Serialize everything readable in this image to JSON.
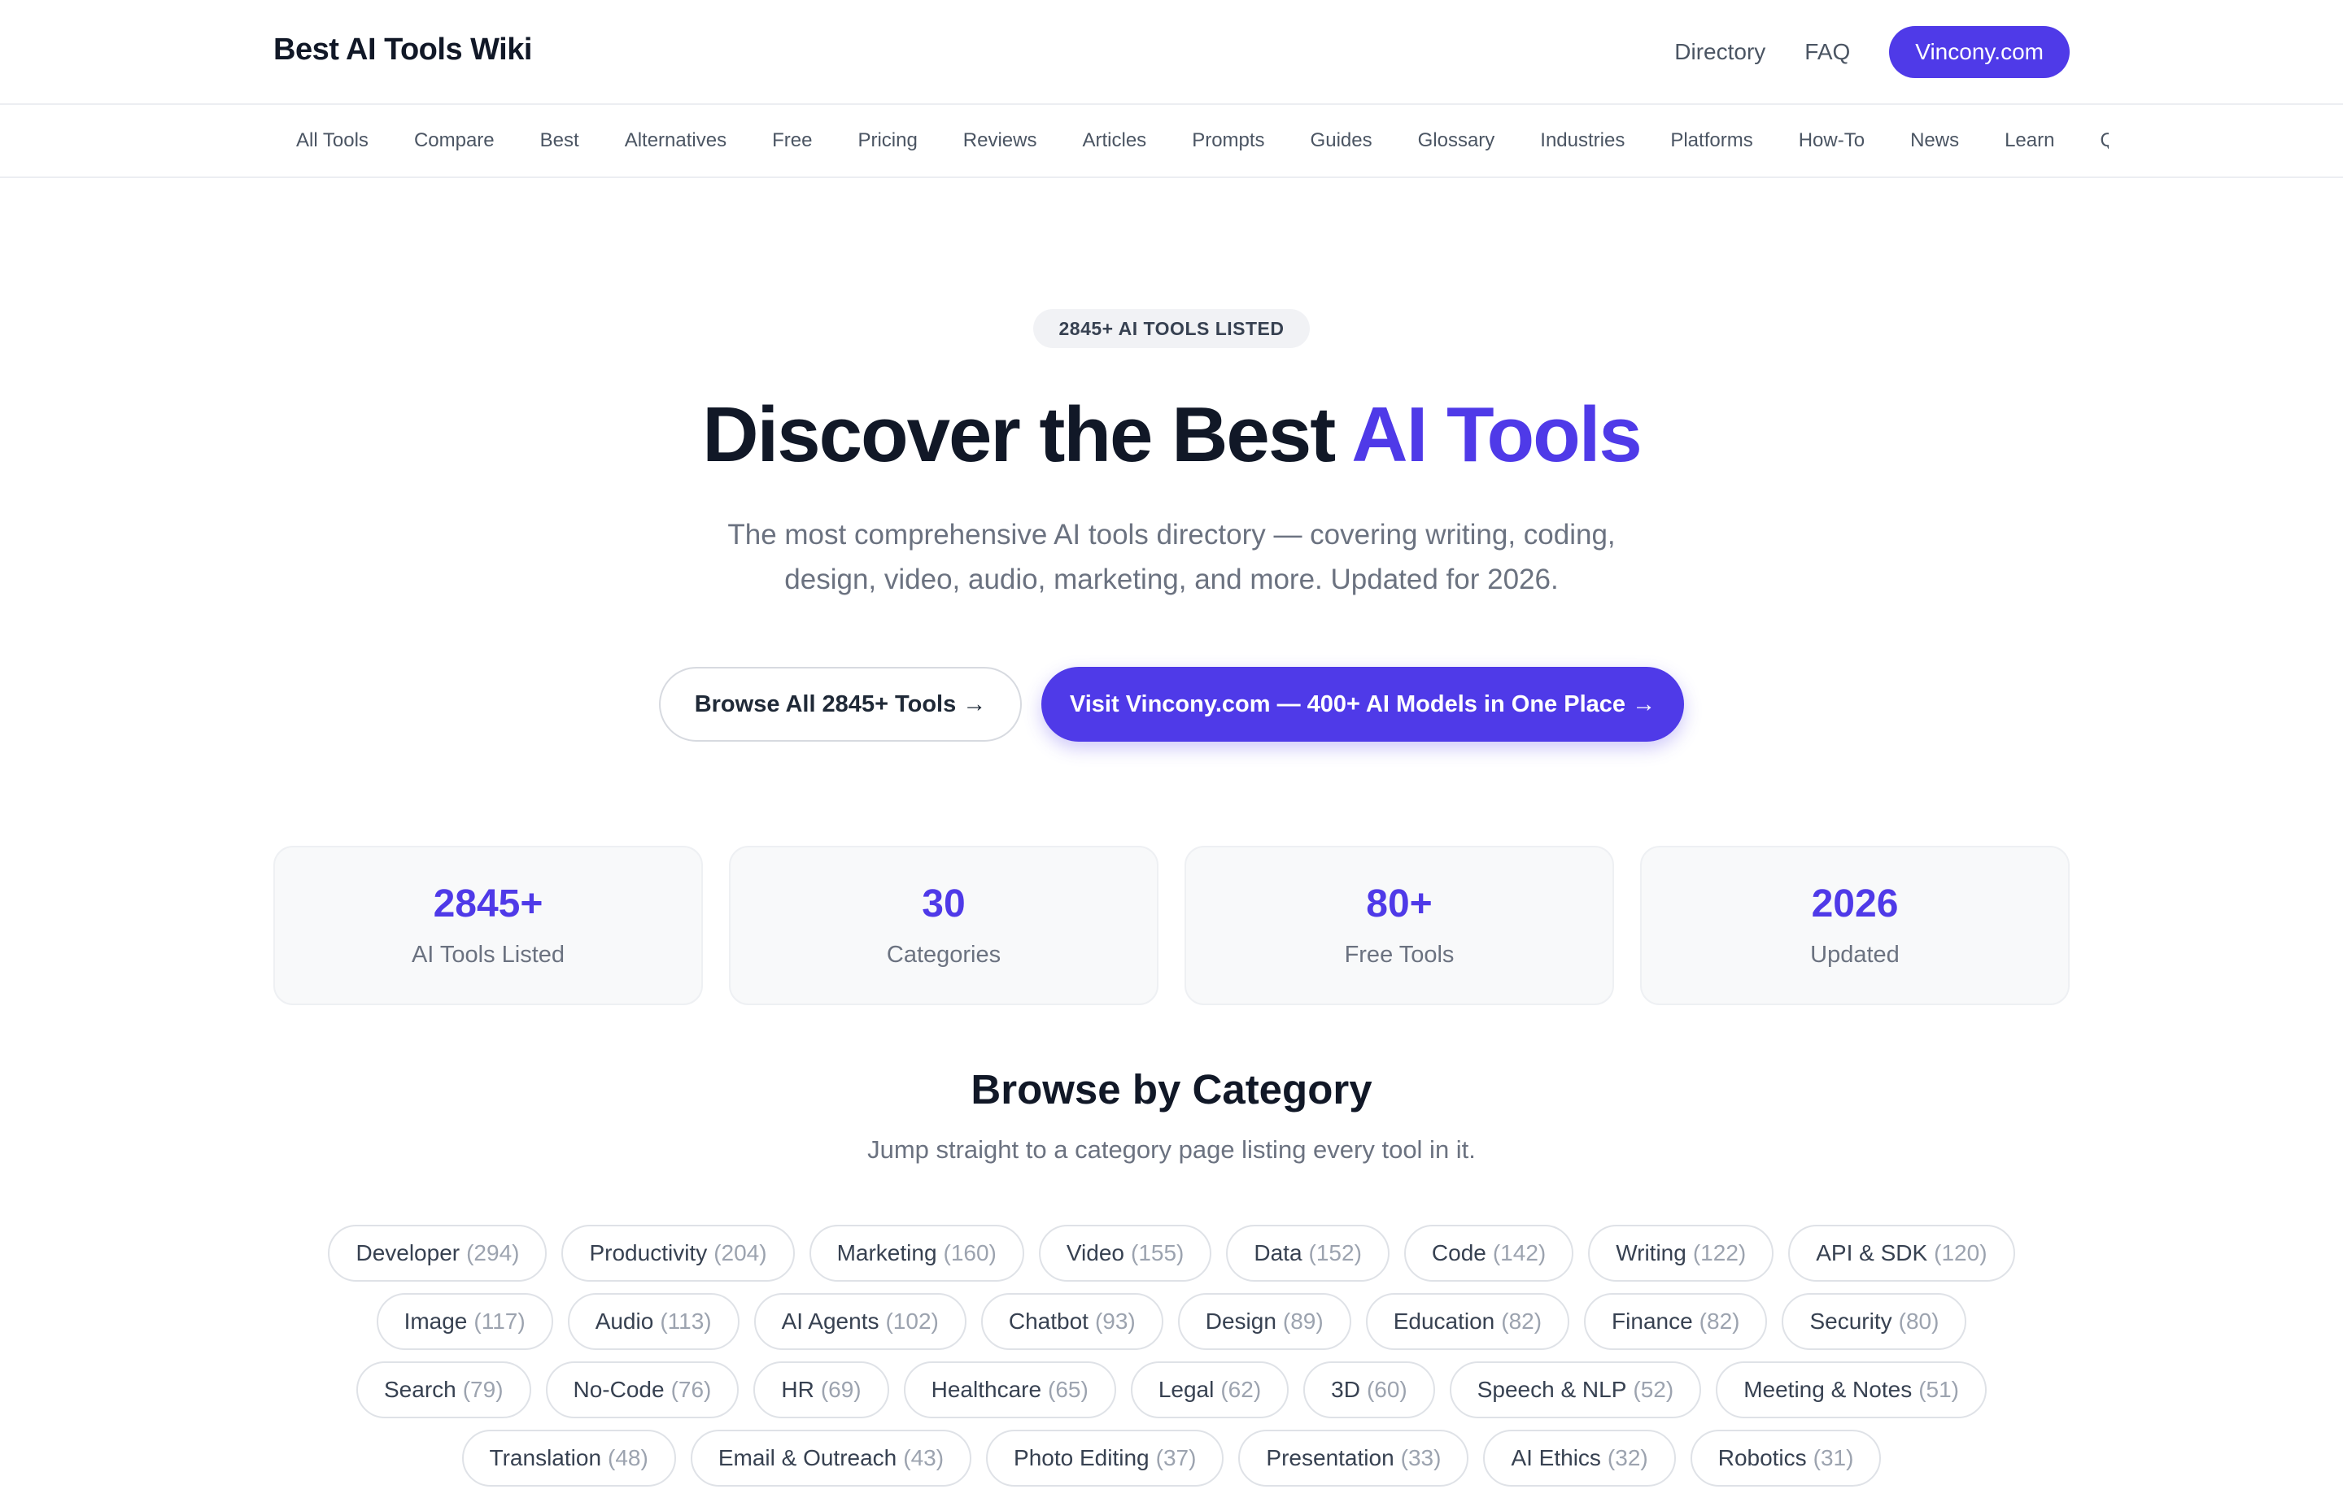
{
  "header": {
    "brand": "Best AI Tools Wiki",
    "nav": [
      "Directory",
      "FAQ"
    ],
    "cta": "Vincony.com"
  },
  "subnav": {
    "items": [
      "All Tools",
      "Compare",
      "Best",
      "Alternatives",
      "Free",
      "Pricing",
      "Reviews",
      "Articles",
      "Prompts",
      "Guides",
      "Glossary",
      "Industries",
      "Platforms",
      "How-To",
      "News",
      "Learn",
      "Q"
    ]
  },
  "hero": {
    "badge": "2845+ AI TOOLS LISTED",
    "title_main": "Discover the Best",
    "title_accent": "AI Tools",
    "subtitle": "The most comprehensive AI tools directory — covering writing, coding, design, video, audio, marketing, and more. Updated for 2026.",
    "button_secondary": "Browse All 2845+ Tools →",
    "button_primary": "Visit Vincony.com — 400+ AI Models in One Place →"
  },
  "stats": [
    {
      "value": "2845+",
      "label": "AI Tools Listed"
    },
    {
      "value": "30",
      "label": "Categories"
    },
    {
      "value": "80+",
      "label": "Free Tools"
    },
    {
      "value": "2026",
      "label": "Updated"
    }
  ],
  "categories_section": {
    "title": "Browse by Category",
    "subtitle": "Jump straight to a category page listing every tool in it.",
    "items": [
      {
        "name": "Developer",
        "count": "(294)"
      },
      {
        "name": "Productivity",
        "count": "(204)"
      },
      {
        "name": "Marketing",
        "count": "(160)"
      },
      {
        "name": "Video",
        "count": "(155)"
      },
      {
        "name": "Data",
        "count": "(152)"
      },
      {
        "name": "Code",
        "count": "(142)"
      },
      {
        "name": "Writing",
        "count": "(122)"
      },
      {
        "name": "API & SDK",
        "count": "(120)"
      },
      {
        "name": "Image",
        "count": "(117)"
      },
      {
        "name": "Audio",
        "count": "(113)"
      },
      {
        "name": "AI Agents",
        "count": "(102)"
      },
      {
        "name": "Chatbot",
        "count": "(93)"
      },
      {
        "name": "Design",
        "count": "(89)"
      },
      {
        "name": "Education",
        "count": "(82)"
      },
      {
        "name": "Finance",
        "count": "(82)"
      },
      {
        "name": "Security",
        "count": "(80)"
      },
      {
        "name": "Search",
        "count": "(79)"
      },
      {
        "name": "No-Code",
        "count": "(76)"
      },
      {
        "name": "HR",
        "count": "(69)"
      },
      {
        "name": "Healthcare",
        "count": "(65)"
      },
      {
        "name": "Legal",
        "count": "(62)"
      },
      {
        "name": "3D",
        "count": "(60)"
      },
      {
        "name": "Speech & NLP",
        "count": "(52)"
      },
      {
        "name": "Meeting & Notes",
        "count": "(51)"
      },
      {
        "name": "Translation",
        "count": "(48)"
      },
      {
        "name": "Email & Outreach",
        "count": "(43)"
      },
      {
        "name": "Photo Editing",
        "count": "(37)"
      },
      {
        "name": "Presentation",
        "count": "(33)"
      },
      {
        "name": "AI Ethics",
        "count": "(32)"
      },
      {
        "name": "Robotics",
        "count": "(31)"
      }
    ]
  },
  "colors": {
    "accent": "#4f3ae8",
    "text": "#111827",
    "muted": "#6b7280"
  }
}
